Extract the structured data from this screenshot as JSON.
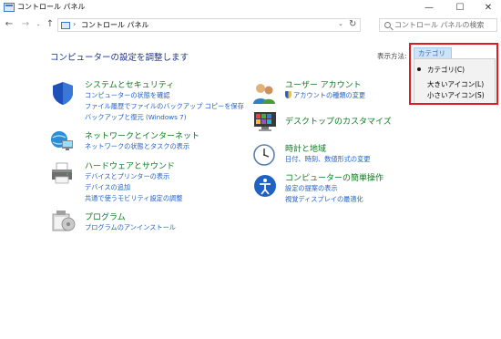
{
  "window": {
    "title": "コントロール パネル",
    "minimize": "—",
    "maximize": "☐",
    "close": "✕"
  },
  "address": {
    "breadcrumb": "コントロール パネル",
    "separator": "›",
    "dropdown": "⌄",
    "refresh": "↻"
  },
  "nav": {
    "back": "←",
    "forward": "→",
    "recent": "⌄",
    "up": "↑"
  },
  "search": {
    "placeholder": "コントロール パネルの検索"
  },
  "main": {
    "heading": "コンピューターの設定を調整します",
    "view_by_label": "表示方法:",
    "view_by_value": "カテゴリ ▾"
  },
  "view_menu": {
    "items": [
      "カテゴリ(C)",
      "大きいアイコン(L)",
      "小さいアイコン(S)"
    ],
    "selected": "カテゴリ(C)"
  },
  "categories": {
    "system_security": {
      "title": "システムとセキュリティ",
      "links": [
        "コンピューターの状態を確認",
        "ファイル履歴でファイルのバックアップ コピーを保存",
        "バックアップと復元 (Windows 7)"
      ]
    },
    "network": {
      "title": "ネットワークとインターネット",
      "links": [
        "ネットワークの状態とタスクの表示"
      ]
    },
    "hardware": {
      "title": "ハードウェアとサウンド",
      "links": [
        "デバイスとプリンターの表示",
        "デバイスの追加",
        "共通で使うモビリティ設定の調整"
      ]
    },
    "programs": {
      "title": "プログラム",
      "links": [
        "プログラムのアンインストール"
      ]
    },
    "user_accounts": {
      "title": "ユーザー アカウント",
      "links": [
        "アカウントの種類の変更"
      ]
    },
    "appearance": {
      "title": "デスクトップのカスタマイズ",
      "links": []
    },
    "clock_region": {
      "title": "時計と地域",
      "links": [
        "日付、時刻、数値形式の変更"
      ]
    },
    "ease_of_access": {
      "title": "コンピューターの簡単操作",
      "links": [
        "設定の提案の表示",
        "視覚ディスプレイの最適化"
      ]
    }
  },
  "colors": {
    "category_title": "#0b7a1f",
    "link": "#1f5fc8",
    "heading": "#1e3287",
    "highlight": "#e21b23"
  }
}
